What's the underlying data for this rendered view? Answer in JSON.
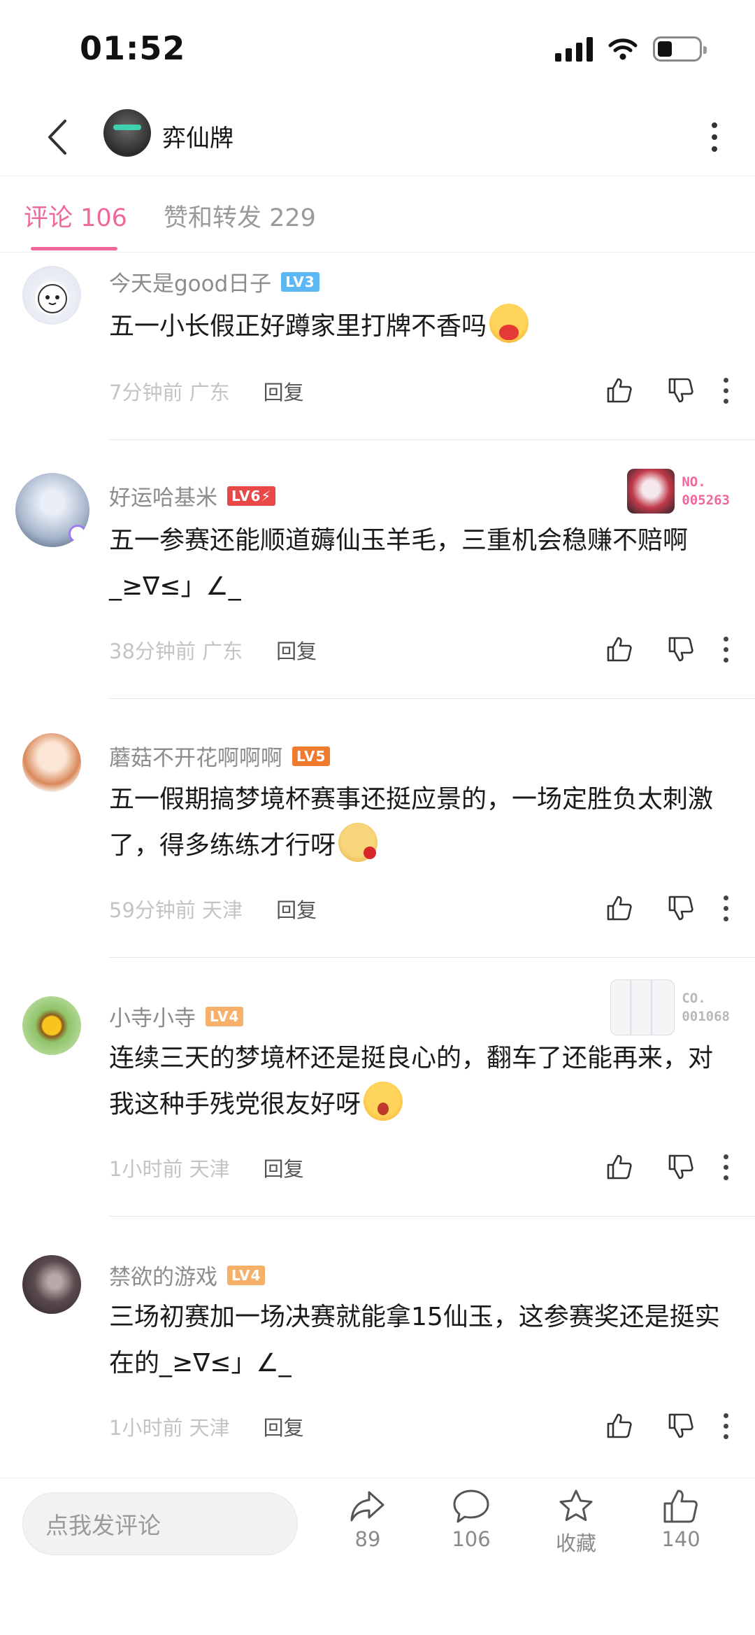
{
  "status_bar": {
    "time": "01:52"
  },
  "header": {
    "title": "弈仙牌"
  },
  "tabs": [
    {
      "label": "评论 106",
      "active": true
    },
    {
      "label": "赞和转发 229",
      "active": false
    }
  ],
  "comments": [
    {
      "username": "今天是good日子",
      "level": "LV3",
      "level_color": "#5bb8f5",
      "text": "五一小长假正好蹲家里打牌不香吗",
      "emoji": "hug-emoji",
      "time_location": "7分钟前 广东",
      "reply_label": "回复"
    },
    {
      "username": "好运哈基米",
      "level": "LV6⚡",
      "level_color": "#e84848",
      "medal": {
        "line1": "NO.",
        "line2": "005263",
        "color": "#f0679d"
      },
      "text": "五一参赛还能顺道薅仙玉羊毛，三重机会稳赚不赔啊_≥∇≤」∠_",
      "time_location": "38分钟前 广东",
      "reply_label": "回复"
    },
    {
      "username": "蘑菇不开花啊啊啊",
      "level": "LV5",
      "level_color": "#f07a2e",
      "text": "五一假期搞梦境杯赛事还挺应景的，一场定胜负太刺激了，得多练练才行呀",
      "emoji": "doge-rose-emoji",
      "time_location": "59分钟前 天津",
      "reply_label": "回复"
    },
    {
      "username": "小寺小寺",
      "level": "LV4",
      "level_color": "#f7b06a",
      "medal": {
        "line1": "CO.",
        "line2": "001068",
        "color": "#b8b8b8"
      },
      "text": "连续三天的梦境杯还是挺良心的，翻车了还能再来，对我这种手残党很友好呀",
      "emoji": "cheer-emoji",
      "time_location": "1小时前 天津",
      "reply_label": "回复"
    },
    {
      "username": "禁欲的游戏",
      "level": "LV4",
      "level_color": "#f7b06a",
      "text": "三场初赛加一场决赛就能拿15仙玉，这参赛奖还是挺实在的_≥∇≤」∠_",
      "time_location": "1小时前 天津",
      "reply_label": "回复"
    }
  ],
  "bottom_bar": {
    "input_placeholder": "点我发评论",
    "share_count": "89",
    "comment_count": "106",
    "favorite_label": "收藏",
    "like_count": "140"
  }
}
